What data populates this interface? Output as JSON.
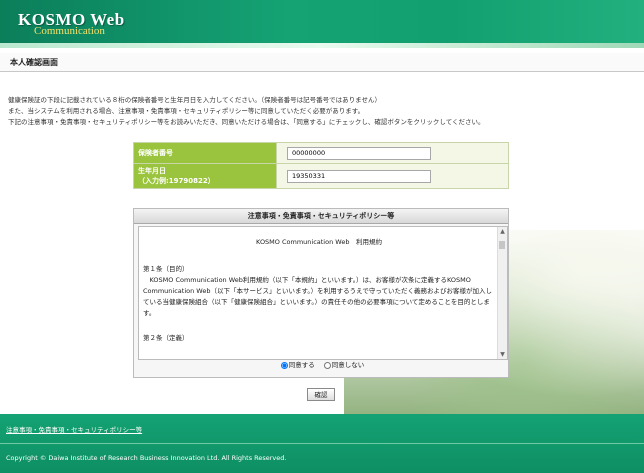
{
  "header": {
    "logo_main": "KOSMO Web",
    "logo_sub": "Communication"
  },
  "page_title": "本人確認画面",
  "instructions": [
    "健康保険証の下段に記載されている８桁の保険者番号と生年月日を入力してください。（保険者番号は記号番号ではありません）",
    "また、当システムを利用される場合、注意事項・免責事項・セキュリティポリシー等に同意していただく必要があります。",
    "下記の注意事項・免責事項・セキュリティポリシー等をお読みいただき、同意いただける場合は、「同意する」にチェックし、確認ボタンをクリックしてください。"
  ],
  "form": {
    "insurer_label": "保険者番号",
    "insurer_value": "00000000",
    "birth_label": "生年月日",
    "birth_example": "（入力例:19790822）",
    "birth_value": "19350331"
  },
  "terms": {
    "title": "注意事項・免責事項・セキュリティポリシー等",
    "doc_title": "KOSMO Communication Web　利用規約",
    "article1_heading": "第１条（目的）",
    "article1_text": "　KOSMO Communication Web利用規約（以下「本規約」といいます。）は、お客様が次条に定義するKOSMO Communication Web（以下「本サービス」といいます。）を利用するうえで守っていただく義務およびお客様が加入している当健康保険組合（以下「健康保険組合」といいます。）の責任その他の必要事項について定めることを目的とします。",
    "article2_heading": "第２条（定義）",
    "agree_label": "同意する",
    "disagree_label": "同意しない"
  },
  "confirm_button": "確認",
  "footer": {
    "link": "注意事項・免責事項・セキュリティポリシー等",
    "copyright": "Copyright © Daiwa Institute of Research Business Innovation Ltd. All Rights Reserved."
  }
}
